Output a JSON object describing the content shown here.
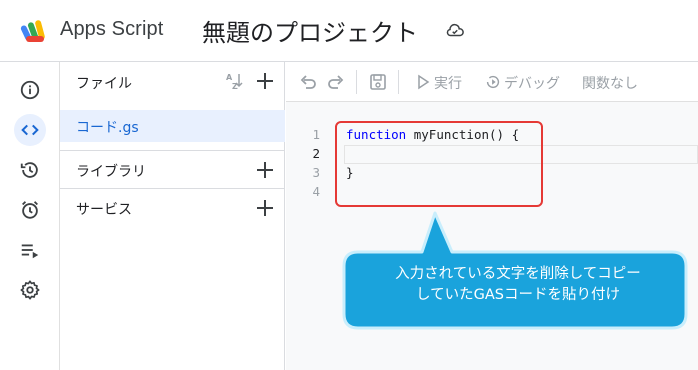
{
  "header": {
    "app_name": "Apps Script",
    "project_title": "無題のプロジェクト",
    "cloud_icon": "cloud-sync-icon"
  },
  "rail": {
    "items": [
      {
        "name": "overview",
        "icon": "info-icon"
      },
      {
        "name": "editor",
        "icon": "code-icon",
        "active": true
      },
      {
        "name": "executions",
        "icon": "history-icon"
      },
      {
        "name": "triggers",
        "icon": "alarm-clock-icon"
      },
      {
        "name": "executions-log",
        "icon": "playlist-icon"
      },
      {
        "name": "settings",
        "icon": "gear-icon"
      }
    ]
  },
  "files_panel": {
    "title": "ファイル",
    "files": [
      {
        "name": "コード.gs",
        "selected": true
      }
    ],
    "libraries_label": "ライブラリ",
    "services_label": "サービス"
  },
  "toolbar": {
    "run_label": "実行",
    "debug_label": "デバッグ",
    "function_select": "関数なし"
  },
  "editor": {
    "lines": [
      {
        "num": "1",
        "keyword": "function",
        "name": "myFunction",
        "rest": "() {"
      },
      {
        "num": "2",
        "text": ""
      },
      {
        "num": "3",
        "text": "}"
      },
      {
        "num": "4",
        "text": ""
      }
    ],
    "current_line": 2
  },
  "annotation": {
    "callout_line1": "入力されている文字を削除してコピー",
    "callout_line2": "していたGASコードを貼り付け"
  },
  "colors": {
    "accent": "#1a73e8",
    "active_bg": "#e8f0fe",
    "callout_fill": "#1aa3dc",
    "callout_border": "#c9eefc",
    "highlight_box": "#e53935"
  }
}
